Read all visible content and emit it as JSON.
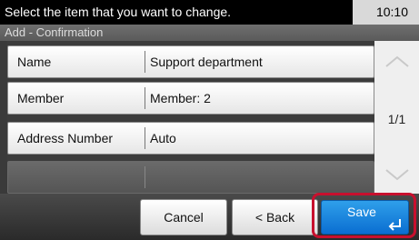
{
  "header": {
    "instruction": "Select the item that you want to change.",
    "time": "10:10",
    "subtitle": "Add - Confirmation"
  },
  "rows": [
    {
      "label": "Name",
      "value": "Support department"
    },
    {
      "label": "Member",
      "value": "Member: 2"
    },
    {
      "label": "Address Number",
      "value": "Auto"
    },
    {
      "label": "",
      "value": ""
    }
  ],
  "scroll": {
    "page": "1/1",
    "up_icon": "chevron-up-icon",
    "down_icon": "chevron-down-icon"
  },
  "footer": {
    "cancel_label": "Cancel",
    "back_label": "< Back",
    "save_label": "Save",
    "enter_icon": "enter-arrow-icon",
    "highlight_color": "#c8102e",
    "save_color": "#0a6ed1"
  }
}
